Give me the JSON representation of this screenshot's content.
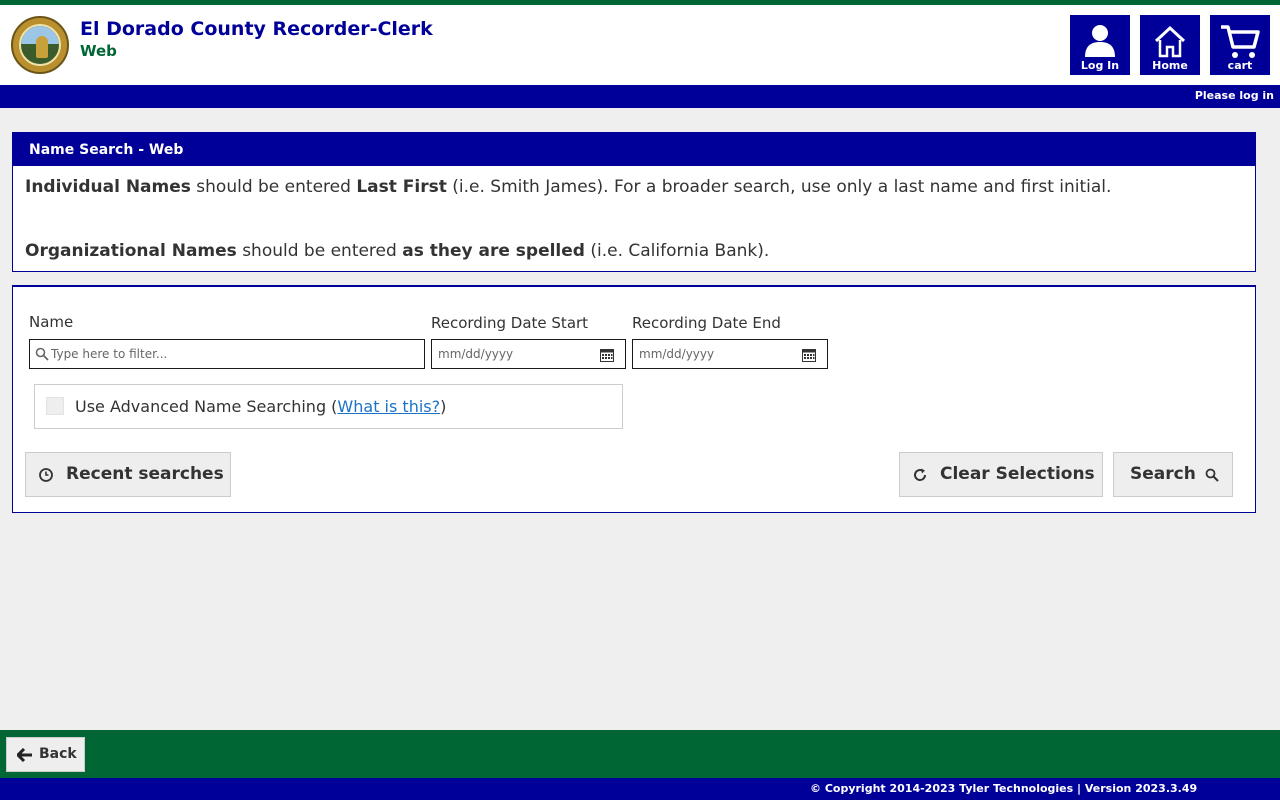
{
  "header": {
    "title": "El Dorado County Recorder-Clerk",
    "subtitle": "Web",
    "seal_text": "EL DORADO COUNTY CALIFORNIA",
    "buttons": [
      {
        "label": "Log In",
        "icon": "user-icon"
      },
      {
        "label": "Home",
        "icon": "home-icon"
      },
      {
        "label": "cart",
        "icon": "cart-icon"
      }
    ]
  },
  "navbar": {
    "status": "Please log in"
  },
  "info": {
    "heading": "Name Search - Web",
    "line1": {
      "b1": "Individual Names",
      "t1": " should be entered ",
      "b2": "Last First",
      "t2": " (i.e. Smith James). For a broader search, use only a last name and first initial."
    },
    "line2": {
      "b1": "Organizational Names",
      "t1": " should be entered ",
      "b2": "as they are spelled",
      "t2": " (i.e. California Bank)."
    }
  },
  "form": {
    "name_label": "Name",
    "name_placeholder": "Type here to filter...",
    "start_label": "Recording Date Start",
    "start_placeholder": "mm/dd/yyyy",
    "end_label": "Recording Date End",
    "end_placeholder": "mm/dd/yyyy",
    "advanced_text": "Use Advanced Name Searching (",
    "advanced_link": "What is this?",
    "advanced_close": ")",
    "advanced_checked": false
  },
  "actions": {
    "recent": "Recent searches",
    "clear": "Clear Selections",
    "search": "Search"
  },
  "footer": {
    "back": "Back",
    "copyright": "© Copyright 2014-2023 Tyler Technologies | Version 2023.3.49"
  },
  "colors": {
    "navy": "#000099",
    "green": "#006633"
  }
}
